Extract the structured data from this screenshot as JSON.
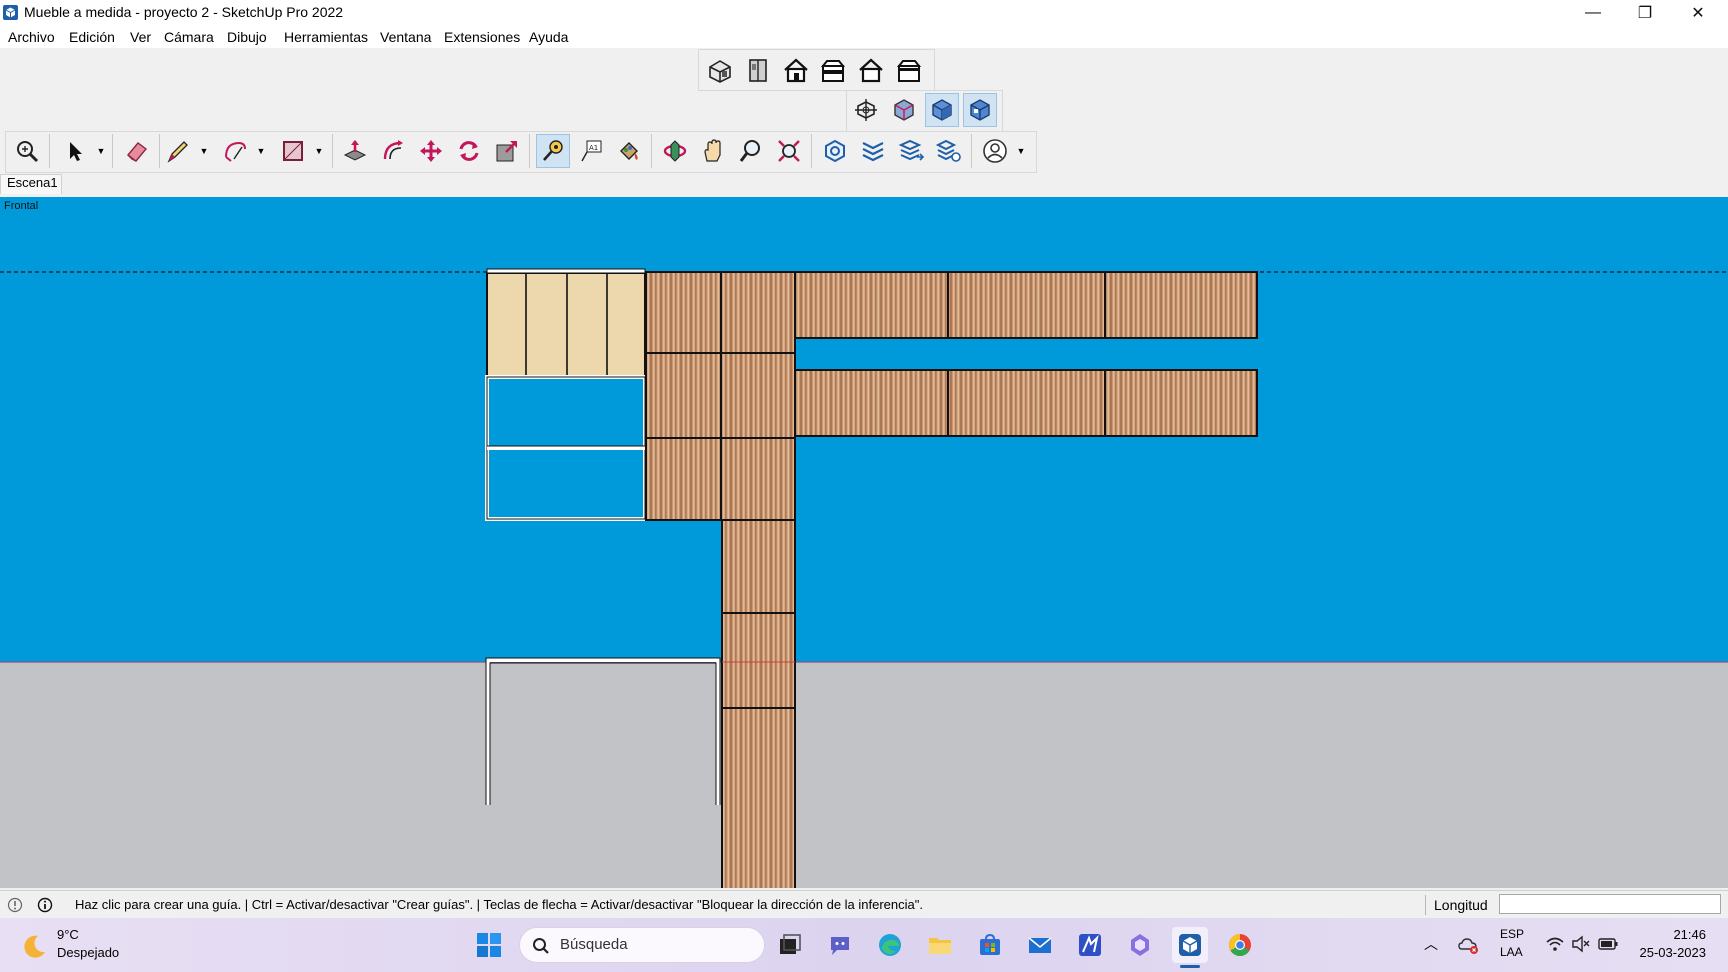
{
  "window": {
    "title": "Mueble a medida - proyecto 2 - SketchUp Pro 2022",
    "controls": {
      "minimize": "—",
      "restore": "❐",
      "close": "✕"
    }
  },
  "menu": [
    "Archivo",
    "Edición",
    "Ver",
    "Cámara",
    "Dibujo",
    "Herramientas",
    "Ventana",
    "Extensiones",
    "Ayuda"
  ],
  "toolbars": {
    "views": [
      "iso-view-icon",
      "top-view-icon",
      "front-view-icon",
      "right-view-icon",
      "back-view-icon",
      "left-view-icon"
    ],
    "styles": [
      "xray-icon",
      "back-edges-icon",
      "shaded-icon",
      "shaded-textures-icon"
    ],
    "main": [
      "zoom-window-icon",
      "select-icon",
      "eraser-icon",
      "line-icon",
      "arc-icon",
      "rectangle-icon",
      "push-pull-icon",
      "offset-icon",
      "move-icon",
      "rotate-icon",
      "scale-icon",
      "tape-measure-icon",
      "text-icon",
      "paint-bucket-icon",
      "orbit-icon",
      "pan-icon",
      "zoom-icon",
      "zoom-extents-icon",
      "model-info-icon",
      "tags-icon",
      "outliner-icon",
      "layers-settings-icon",
      "account-icon"
    ],
    "active_tool": "tape-measure-icon"
  },
  "scenes": {
    "tabs": [
      "Escena1"
    ]
  },
  "viewport": {
    "view_label": "Frontal",
    "sky_color": "#0099d9",
    "ground_color": "#c2c3c7"
  },
  "status": {
    "message": "Haz clic para crear una guía. | Ctrl = Activar/desactivar \"Crear guías\". | Teclas de flecha = Activar/desactivar \"Bloquear la dirección de la inferencia\".",
    "measure_label": "Longitud",
    "measure_value": ""
  },
  "taskbar": {
    "weather_temp": "9°C",
    "weather_desc": "Despejado",
    "search_placeholder": "Búsqueda",
    "lang_top": "ESP",
    "lang_bottom": "LAA",
    "time": "21:46",
    "date": "25-03-2023"
  }
}
